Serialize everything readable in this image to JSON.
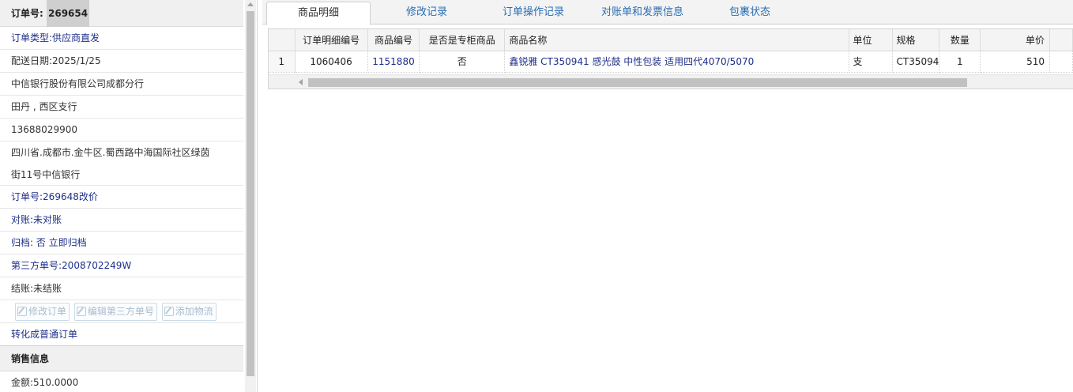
{
  "order_panel": {
    "order_label": "订单号:",
    "order_number": "269654",
    "order_type": "订单类型:供应商直发",
    "delivery_date": "配送日期:2025/1/25",
    "company": "中信银行股份有限公司成都分行",
    "contact": "田丹 , 西区支行",
    "phone": "13688029900",
    "address_line1": "四川省.成都市.金牛区.蜀西路中海国际社区绿茵",
    "address_line2": "街11号中信银行",
    "related_order": "订单号:269648改价",
    "reconcile": "对账:未对账",
    "archive": "归档: 否 立即归档",
    "third_party_no": "第三方单号:2008702249W",
    "settle": "结账:未结账",
    "buttons": {
      "edit_order": "修改订单",
      "edit_third_party": "编辑第三方单号",
      "add_logistics": "添加物流"
    },
    "convert_link": "转化成普通订单",
    "sales_section_title": "销售信息",
    "amount": "金额:510.0000"
  },
  "tabs": [
    {
      "label": "商品明细",
      "active": true
    },
    {
      "label": "修改记录",
      "active": false
    },
    {
      "label": "订单操作记录",
      "active": false
    },
    {
      "label": "对账单和发票信息",
      "active": false
    },
    {
      "label": "包裹状态",
      "active": false
    }
  ],
  "grid": {
    "columns": [
      "订单明细编号",
      "商品编号",
      "是否是专柜商品",
      "商品名称",
      "单位",
      "规格",
      "数量",
      "单价"
    ],
    "rows": [
      {
        "row_number": "1",
        "detail_id": "1060406",
        "product_id": "1151880",
        "is_counter": "否",
        "name": "鑫锐雅 CT350941 感光鼓 中性包装 适用四代4070/5070",
        "unit": "支",
        "spec": "CT35094",
        "qty": "1",
        "price": "510"
      }
    ]
  },
  "colors": {
    "link_blue": "#1f2f8a",
    "tab_blue": "#2a6db3",
    "header_bg": "#f4f4f4"
  }
}
